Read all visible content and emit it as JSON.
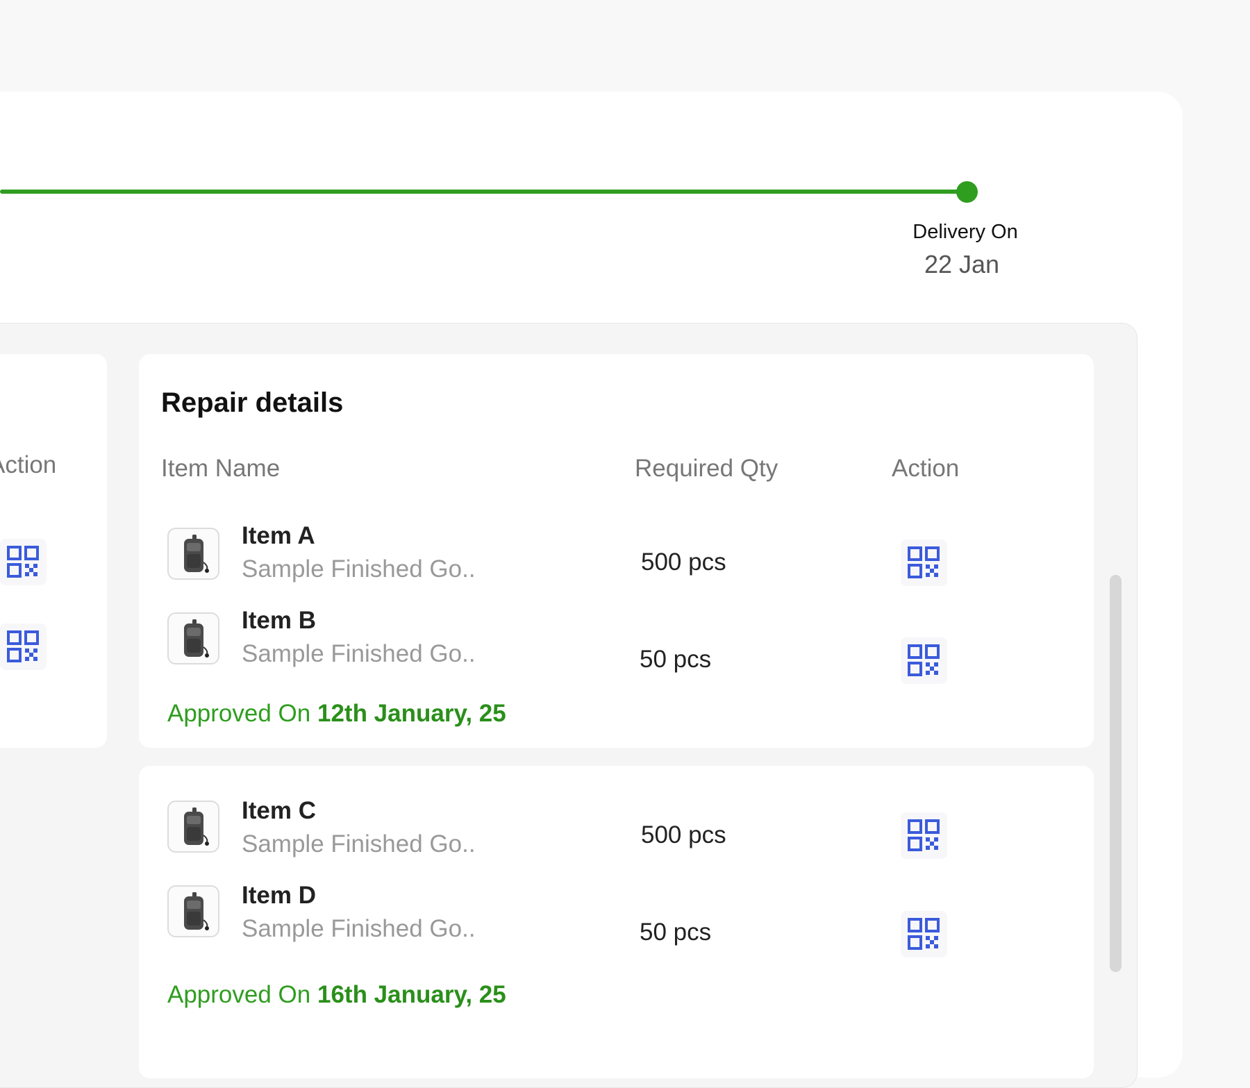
{
  "timeline": {
    "delivery_label": "Delivery On",
    "delivery_date": "22 Jan"
  },
  "left_card": {
    "action_header": "Action"
  },
  "repair": {
    "title": "Repair details",
    "columns": {
      "item_name": "Item Name",
      "required_qty": "Required Qty",
      "action": "Action"
    },
    "groups": [
      {
        "items": [
          {
            "name": "Item A",
            "subtitle": "Sample Finished Go..",
            "qty": "500 pcs"
          },
          {
            "name": "Item B",
            "subtitle": "Sample Finished Go..",
            "qty": "50 pcs"
          }
        ],
        "approved_prefix": "Approved On",
        "approved_date": "12th January, 25"
      },
      {
        "items": [
          {
            "name": "Item C",
            "subtitle": "Sample Finished Go..",
            "qty": "500 pcs"
          },
          {
            "name": "Item D",
            "subtitle": "Sample Finished Go..",
            "qty": "50 pcs"
          }
        ],
        "approved_prefix": "Approved On",
        "approved_date": "16th January, 25"
      }
    ]
  },
  "icons": {
    "action": "qr-code-icon",
    "item_thumbnail": "backpack-icon"
  },
  "colors": {
    "accent_green": "#2f9d1f",
    "qr_blue": "#3b5bdb"
  }
}
